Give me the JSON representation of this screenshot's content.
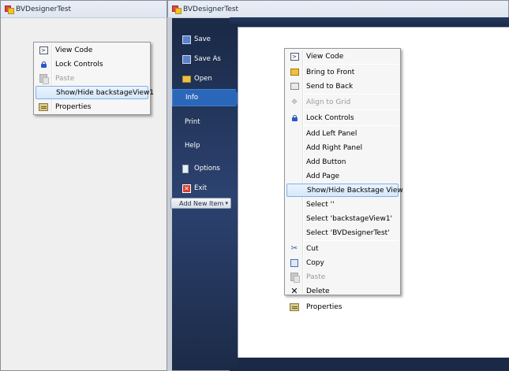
{
  "left_window": {
    "title": "BVDesignerTest"
  },
  "right_window": {
    "title": "BVDesignerTest"
  },
  "left_menu": {
    "items": [
      {
        "label": "View Code",
        "icon": "view-code-icon",
        "disabled": false
      },
      {
        "label": "Lock Controls",
        "icon": "lock-icon",
        "disabled": false
      },
      {
        "label": "Paste",
        "icon": "paste-icon",
        "disabled": true
      },
      {
        "label": "Show/Hide backstageView1",
        "icon": "",
        "disabled": false,
        "highlighted": true
      },
      {
        "label": "Properties",
        "icon": "properties-icon",
        "disabled": false
      }
    ]
  },
  "sidebar": {
    "items": [
      {
        "label": "Save",
        "icon": "save-icon"
      },
      {
        "label": "Save As",
        "icon": "save-as-icon"
      },
      {
        "label": "Open",
        "icon": "open-folder-icon"
      },
      {
        "label": "Info",
        "icon": "",
        "active": true
      },
      {
        "label": "Print",
        "icon": ""
      },
      {
        "label": "Help",
        "icon": ""
      },
      {
        "label": "Options",
        "icon": "options-icon"
      },
      {
        "label": "Exit",
        "icon": "exit-icon"
      }
    ],
    "add_new_item": "Add New Item"
  },
  "right_menu": {
    "items": [
      {
        "label": "View Code",
        "icon": "view-code-icon"
      },
      {
        "label": "Bring to Front",
        "icon": "bring-to-front-icon"
      },
      {
        "label": "Send to Back",
        "icon": "send-to-back-icon"
      },
      {
        "label": "Align to Grid",
        "icon": "align-to-grid-icon",
        "disabled": true
      },
      {
        "label": "Lock Controls",
        "icon": "lock-icon"
      },
      {
        "label": "Add Left Panel"
      },
      {
        "label": "Add Right Panel"
      },
      {
        "label": "Add Button"
      },
      {
        "label": "Add Page"
      },
      {
        "label": "Show/Hide Backstage View",
        "highlighted": true
      },
      {
        "label": "Select ''"
      },
      {
        "label": "Select 'backstageView1'"
      },
      {
        "label": "Select 'BVDesignerTest'"
      },
      {
        "label": "Cut",
        "icon": "cut-icon"
      },
      {
        "label": "Copy",
        "icon": "copy-icon"
      },
      {
        "label": "Paste",
        "icon": "paste-icon",
        "disabled": true
      },
      {
        "label": "Delete",
        "icon": "delete-icon"
      },
      {
        "label": "Properties",
        "icon": "properties-icon"
      }
    ]
  },
  "colors": {
    "highlight": "#d6e8fb",
    "sidebar_bg": "#2c4270",
    "sidebar_active": "#2b67b9"
  }
}
